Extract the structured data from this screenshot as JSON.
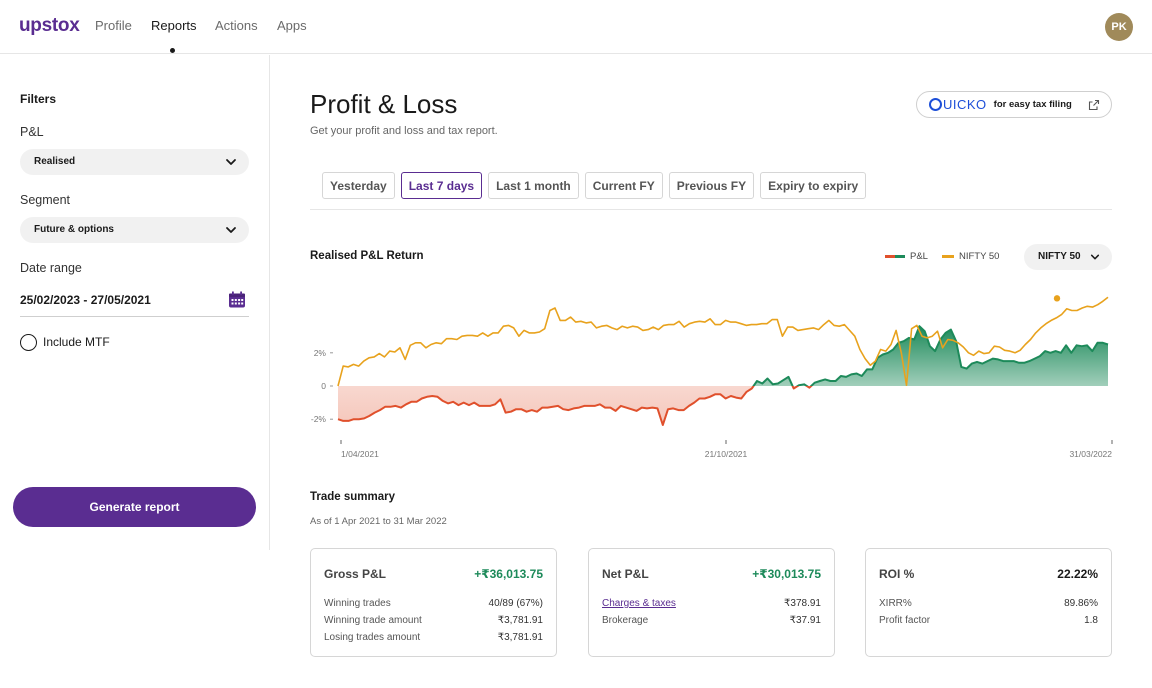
{
  "nav": {
    "logo": "upstox",
    "items": [
      {
        "label": "Profile"
      },
      {
        "label": "Reports"
      },
      {
        "label": "Actions"
      },
      {
        "label": "Apps"
      }
    ],
    "avatar_initials": "PK"
  },
  "sidebar": {
    "title": "Filters",
    "pl_label": "P&L",
    "pl_value": "Realised",
    "segment_label": "Segment",
    "segment_value": "Future & options",
    "date_label": "Date range",
    "date_value": "25/02/2023 - 27/05/2021",
    "mtf_label": "Include MTF",
    "generate_label": "Generate report"
  },
  "main": {
    "title": "Profit & Loss",
    "subtitle": "Get your profit and loss and tax report.",
    "quicko_brand": "UICKO",
    "quicko_text": "for easy tax filing",
    "tabs": [
      {
        "label": "Yesterday"
      },
      {
        "label": "Last 7 days",
        "active": true
      },
      {
        "label": "Last 1 month"
      },
      {
        "label": "Current FY"
      },
      {
        "label": "Previous FY"
      },
      {
        "label": "Expiry to expiry"
      }
    ]
  },
  "chart": {
    "title": "Realised P&L Return",
    "legend_pl": "P&L",
    "legend_nifty": "NIFTY 50",
    "index_select": "NIFTY 50",
    "colors": {
      "loss": "#e0502c",
      "profit": "#1d8a5a",
      "nifty": "#e8a21d"
    }
  },
  "chart_data": {
    "type": "line",
    "ylim": [
      -3,
      5.5
    ],
    "y_ticks": [
      "2%",
      "0",
      "-2%"
    ],
    "x_ticks": [
      "1/04/2021",
      "21/10/2021",
      "31/03/2022"
    ],
    "series": [
      {
        "name": "P&L",
        "values": [
          -2,
          -2.1,
          -2.1,
          -2,
          -2,
          -1.95,
          -1.8,
          -1.6,
          -1.45,
          -1.25,
          -1.25,
          -1.2,
          -1.3,
          -1.1,
          -0.95,
          -0.95,
          -0.75,
          -0.65,
          -0.6,
          -0.65,
          -0.9,
          -1.05,
          -0.95,
          -1.15,
          -1.0,
          -1.15,
          -1.0,
          -1.2,
          -1.2,
          -1.2,
          -1.1,
          -0.8,
          -1.6,
          -1.55,
          -1.4,
          -1.4,
          -1.55,
          -1.45,
          -1.55,
          -1.3,
          -1.3,
          -1.25,
          -1.2,
          -1.4,
          -1.45,
          -1.35,
          -1.3,
          -1.2,
          -1.2,
          -1.2,
          -1.1,
          -1.3,
          -1.3,
          -1.5,
          -1.2,
          -1.3,
          -1.4,
          -1.5,
          -1.3,
          -1.35,
          -1.3,
          -1.35,
          -2.35,
          -1.4,
          -1.35,
          -1.45,
          -1.45,
          -1.2,
          -1.0,
          -0.75,
          -0.75,
          -0.65,
          -0.5,
          -0.5,
          -0.75,
          -0.6,
          -0.7,
          -0.75,
          -0.35,
          -0.15,
          0.3,
          0.15,
          0.45,
          0.1,
          0.15,
          0.35,
          0.55,
          -0.15,
          0.05,
          0.1,
          -0.1,
          0.2,
          0.3,
          0.4,
          0.3,
          0.3,
          0.6,
          0.55,
          0.7,
          0.75,
          0.6,
          1.0,
          1.0,
          1.7,
          1.9,
          2.0,
          2.2,
          2.6,
          2.7,
          2.9,
          2.8,
          3.6,
          3.3,
          2.4,
          2.1,
          2.8,
          3.2,
          3.4,
          2.7,
          1.15,
          1.05,
          1.35,
          1.45,
          1.35,
          1.5,
          1.65,
          1.6,
          1.5,
          1.5,
          1.5,
          1.4,
          1.4,
          1.5,
          1.65,
          1.8,
          2.1,
          2.0,
          2.1,
          2.0,
          2.45,
          2.0,
          2.45,
          2.4,
          2.45,
          2.1,
          2.6,
          2.6,
          2.5
        ]
      },
      {
        "name": "NIFTY 50",
        "values": [
          0,
          1.2,
          1.15,
          1.3,
          1.2,
          1.5,
          1.7,
          1.75,
          1.95,
          1.75,
          2.1,
          2.05,
          2.3,
          1.6,
          2.45,
          2.6,
          2.6,
          2.3,
          2.5,
          2.6,
          2.55,
          2.85,
          2.85,
          2.8,
          3.0,
          3.05,
          3.05,
          3.0,
          3.2,
          3.0,
          3.2,
          3.2,
          3.6,
          3.65,
          3.5,
          3.0,
          3.35,
          3.2,
          3.2,
          3.25,
          3.45,
          4.55,
          4.7,
          3.95,
          3.95,
          4.15,
          3.85,
          3.9,
          3.8,
          3.85,
          3.5,
          3.6,
          3.65,
          3.5,
          3.4,
          3.6,
          3.5,
          3.6,
          3.55,
          3.35,
          3.4,
          3.55,
          3.4,
          3.65,
          3.7,
          3.7,
          3.9,
          3.55,
          3.75,
          3.85,
          3.9,
          3.85,
          4.05,
          3.7,
          3.7,
          3.95,
          3.85,
          3.85,
          3.75,
          3.65,
          3.7,
          3.7,
          3.75,
          3.75,
          4.0,
          4.0,
          3.0,
          3.55,
          3.55,
          3.35,
          3.4,
          3.45,
          3.5,
          3.4,
          3.7,
          3.95,
          3.65,
          3.6,
          3.7,
          3.35,
          3.0,
          2.2,
          1.65,
          1.25,
          1.5,
          2.2,
          2.1,
          2.5,
          3.35,
          2.0,
          0.05,
          3.45,
          3.65,
          3.0,
          2.9,
          3.0,
          3.3,
          2.3,
          2.8,
          2.75,
          2.6,
          2.35,
          2.0,
          1.85,
          2.1,
          1.95,
          2.0,
          2.4,
          2.35,
          2.15,
          2.1,
          2.0,
          2.15,
          2.5,
          2.8,
          3.2,
          3.5,
          3.75,
          3.95,
          4.1,
          4.3,
          4.65,
          4.55,
          4.55,
          4.7,
          4.8,
          4.75,
          4.9,
          5.1,
          5.35
        ]
      }
    ]
  },
  "summary": {
    "title": "Trade summary",
    "subtitle": "As of 1 Apr 2021 to 31 Mar 2022",
    "cards": [
      {
        "label": "Gross P&L",
        "value": "+₹36,013.75",
        "rows": [
          {
            "k": "Winning trades",
            "v": "40/89 (67%)"
          },
          {
            "k": "Winning trade amount",
            "v": "₹3,781.91"
          },
          {
            "k": "Losing trades amount",
            "v": "₹3,781.91"
          }
        ]
      },
      {
        "label": "Net P&L",
        "value": "+₹30,013.75",
        "rows": [
          {
            "k": "Charges & taxes",
            "v": "₹378.91"
          },
          {
            "k": "Brokerage",
            "v": "₹37.91"
          }
        ]
      },
      {
        "label": "ROI %",
        "value": "22.22%",
        "rows": [
          {
            "k": "XIRR%",
            "v": "89.86%"
          },
          {
            "k": "Profit factor",
            "v": "1.8"
          }
        ]
      }
    ]
  }
}
